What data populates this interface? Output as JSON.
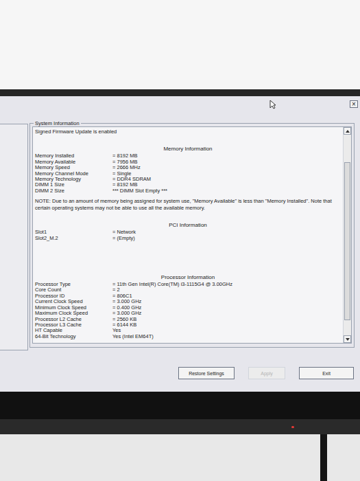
{
  "window": {
    "close": "×"
  },
  "group": {
    "title": "System Information"
  },
  "header_line": "Signed Firmware Update is enabled",
  "sections": [
    {
      "title": "Memory Information",
      "rows": [
        {
          "label": "Memory Installed",
          "value": "= 8192 MB"
        },
        {
          "label": "Memory Available",
          "value": "= 7956 MB"
        },
        {
          "label": "Memory Speed",
          "value": "= 2666 MHz"
        },
        {
          "label": "Memory Channel Mode",
          "value": "= Single"
        },
        {
          "label": "Memory Technology",
          "value": "= DDR4 SDRAM"
        },
        {
          "label": "DIMM 1 Size",
          "value": "= 8192 MB"
        },
        {
          "label": "DIMM 2 Size",
          "value": "*** DIMM Slot Empty ***"
        }
      ],
      "note": "NOTE: Due to an amount of memory being assigned for system use, \"Memory Available\" is less than \"Memory Installed\". Note that certain operating systems may not be able to use all the available memory."
    },
    {
      "title": "PCI Information",
      "rows": [
        {
          "label": "Slot1",
          "value": "= Network"
        },
        {
          "label": "Slot2_M.2",
          "value": "= (Empty)"
        }
      ],
      "note": ""
    },
    {
      "title": "Processor Information",
      "rows": [
        {
          "label": "Processor Type",
          "value": "= 11th Gen Intel(R) Core(TM) i3-1115G4 @ 3.00GHz"
        },
        {
          "label": "Core Count",
          "value": "= 2"
        },
        {
          "label": "Processor ID",
          "value": "= 806C1"
        },
        {
          "label": "Current Clock Speed",
          "value": "= 3.000 GHz"
        },
        {
          "label": "Minimum Clock Speed",
          "value": "= 0.400 GHz"
        },
        {
          "label": "Maximum Clock Speed",
          "value": "= 3.000 GHz"
        },
        {
          "label": "Processor L2 Cache",
          "value": "= 2560 KB"
        },
        {
          "label": "Processor L3 Cache",
          "value": "= 6144 KB"
        },
        {
          "label": "HT Capable",
          "value": "Yes"
        },
        {
          "label": "64-Bit Technology",
          "value": "Yes (Intel EM64T)"
        }
      ],
      "note": ""
    }
  ],
  "buttons": [
    {
      "label": "Restore Settings",
      "disabled": false
    },
    {
      "label": "Apply",
      "disabled": true
    },
    {
      "label": "Exit",
      "disabled": false
    }
  ]
}
